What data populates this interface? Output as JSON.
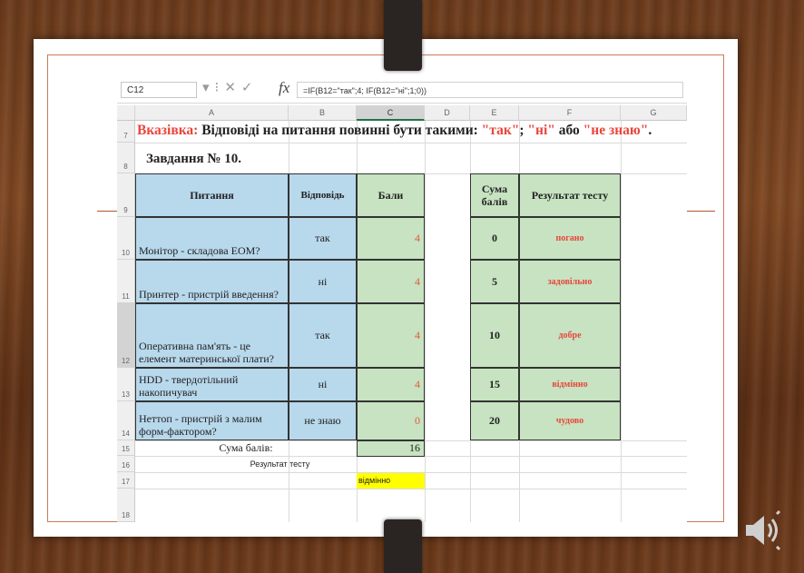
{
  "formula_bar": {
    "name_box": "C12",
    "formula": "=IF(B12=\"так\";4; IF(B12=\"ні\";1;0))"
  },
  "columns": [
    "A",
    "B",
    "C",
    "D",
    "E",
    "F",
    "G"
  ],
  "rows": [
    "7",
    "8",
    "9",
    "10",
    "11",
    "12",
    "13",
    "14",
    "15",
    "16",
    "17",
    "18"
  ],
  "hint": {
    "prefix": "Вказівка:",
    "text": " Відповіді на питання повинні бути такими: ",
    "options": "\"так\"; \"ні\" або \"не знаю\".",
    "options_parts": [
      "\"так\"",
      "; ",
      "\"ні\"",
      " або ",
      "\"не знаю\"",
      "."
    ]
  },
  "task_title": "Завдання № 10.",
  "table_headers": {
    "question": "Питання",
    "answer": "Відповідь",
    "points": "Бали"
  },
  "questions": [
    {
      "q": "Монітор - складова ЕОМ?",
      "a": "так",
      "p": "4"
    },
    {
      "q": "Принтер - пристрій введення?",
      "a": "ні",
      "p": "4"
    },
    {
      "q": "Оперативна пам'ять - це елемент материнської плати?",
      "a": "так",
      "p": "4"
    },
    {
      "q": "HDD - твердотільний накопичувач",
      "a": "ні",
      "p": "4"
    },
    {
      "q": "Неттоп - пристрій з малим форм-фактором?",
      "a": "не знаю",
      "p": "0"
    }
  ],
  "sum_label": "Сума балів:",
  "sum_value": "16",
  "result_label": "Результат тесту",
  "result_value": "відмінно",
  "scale_headers": {
    "sum": "Сума балів",
    "result": "Результат тесту"
  },
  "scale": [
    {
      "points": "0",
      "result": "погано"
    },
    {
      "points": "5",
      "result": "задовільно"
    },
    {
      "points": "10",
      "result": "добре"
    },
    {
      "points": "15",
      "result": "відмінно"
    },
    {
      "points": "20",
      "result": "чудово"
    }
  ],
  "colors": {
    "hint_red": "#e8463c",
    "header_blue": "#b8d8ec",
    "score_green": "#c7e3c1",
    "result_yellow": "#ffff00",
    "frame_accent": "#b5532d"
  },
  "icons": [
    "speaker-icon",
    "cancel-icon",
    "confirm-icon",
    "function-icon"
  ]
}
